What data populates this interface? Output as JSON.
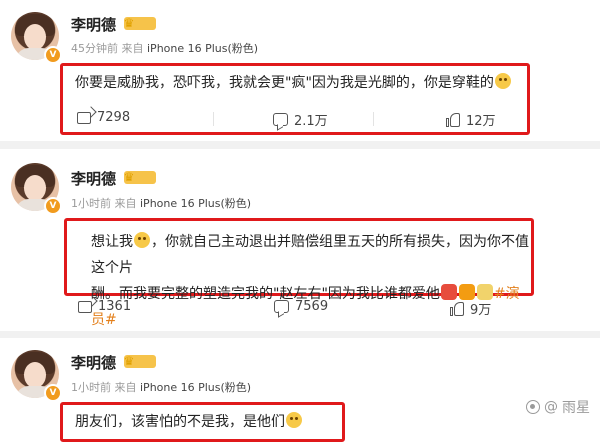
{
  "posts": [
    {
      "author": "李明德",
      "badge": "V",
      "time": "45分钟前",
      "source_prefix": "来自",
      "device": "iPhone 16 Plus(粉色)",
      "text_lines": [
        "你要是威胁我，恐吓我，我就会更\"疯\"因为我是光脚的，你是穿鞋的"
      ],
      "share": "7298",
      "comment": "2.1万",
      "like": "12万"
    },
    {
      "author": "李明德",
      "badge": "V",
      "time": "1小时前",
      "source_prefix": "来自",
      "device": "iPhone 16 Plus(粉色)",
      "text_lines": [
        "想让我",
        "，你就自己主动退出并赔偿组里五天的所有损失，因为你不值这个片",
        "酬。而我要完整的塑造完我的\"赵左右\"因为我比谁都爱他",
        "#演员#"
      ],
      "share": "1361",
      "comment": "7569",
      "like": "9万"
    },
    {
      "author": "李明德",
      "badge": "V",
      "time": "1小时前",
      "source_prefix": "来自",
      "device": "iPhone 16 Plus(粉色)",
      "text_lines": [
        "朋友们，该害怕的不是我，是他们"
      ]
    }
  ],
  "watermark": "雨星",
  "icons": {
    "share": "share-icon",
    "comment": "comment-icon",
    "like": "like-icon",
    "verified": "verified-badge-icon",
    "vip": "vip-crown-icon",
    "emoji": "emoji-icon"
  },
  "colors": {
    "highlight": "#e0191b",
    "topic": "#e3801c",
    "verified": "#f19b1e",
    "vip": "#f6c34a",
    "meta": "#9a9a9a"
  }
}
